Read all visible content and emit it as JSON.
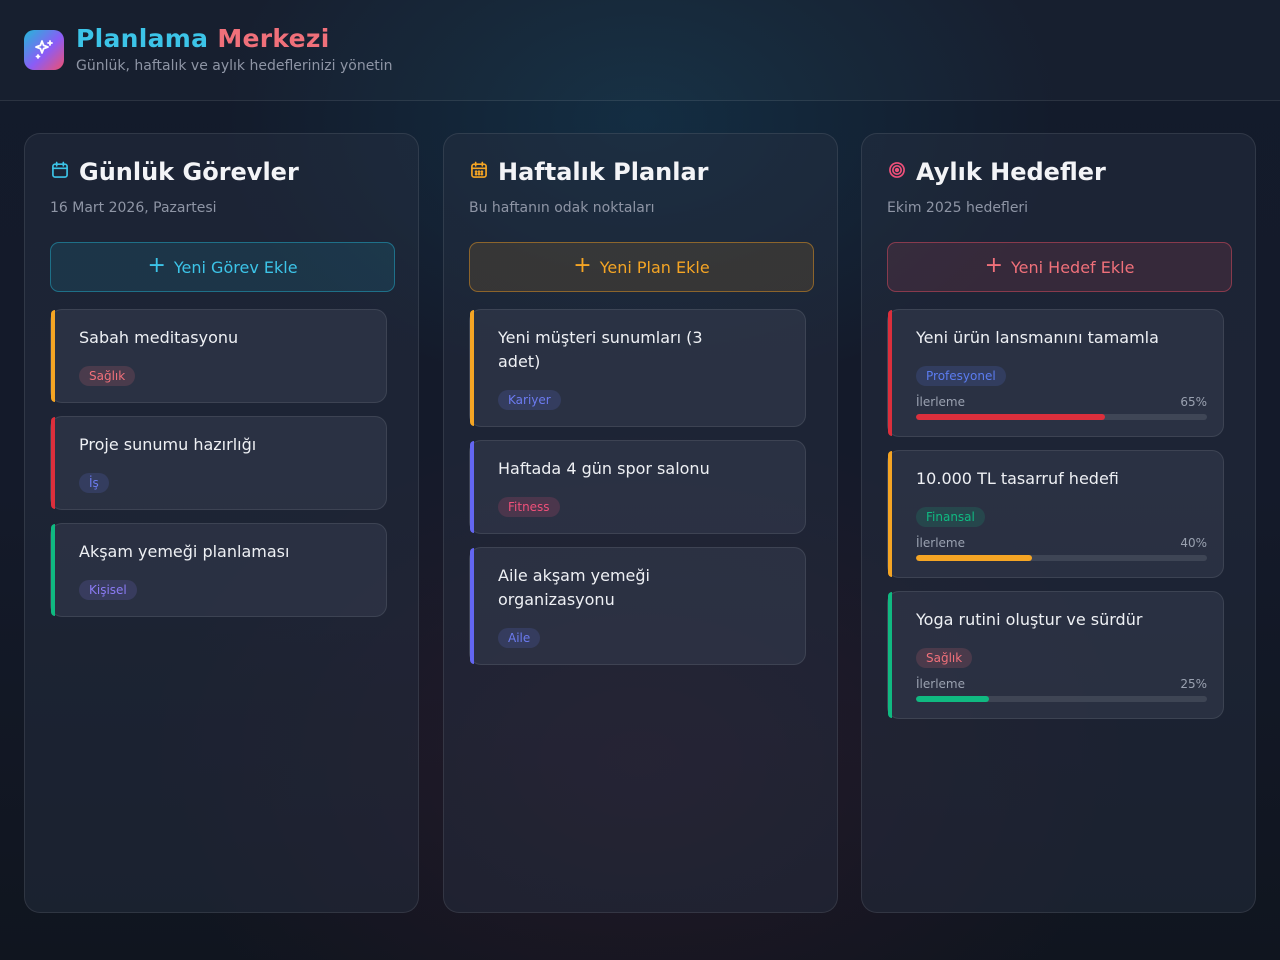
{
  "header": {
    "title_part1": "Planlama",
    "title_part2": "Merkezi",
    "subtitle": "Günlük, haftalık ve aylık hedeflerinizi yönetin",
    "logo_icon": "sparkles-icon"
  },
  "colors": {
    "cyan": "#3cc4e8",
    "orange": "#f5a524",
    "red": "#f0707a",
    "accent_red": "#dc2f3c",
    "accent_green": "#10b981",
    "accent_indigo": "#6366f1"
  },
  "daily": {
    "icon": "calendar-icon",
    "title": "Günlük Görevler",
    "subtitle": "16 Mart 2026, Pazartesi",
    "add_label": "Yeni Görev Ekle",
    "cards": [
      {
        "title": "Sabah meditasyonu",
        "tag": "Sağlık",
        "tag_color": "#f0707a",
        "accent": "#f5a524"
      },
      {
        "title": "Proje sunumu hazırlığı",
        "tag": "İş",
        "tag_color": "#6c7bf0",
        "accent": "#dc2f3c"
      },
      {
        "title": "Akşam yemeği planlaması",
        "tag": "Kişisel",
        "tag_color": "#8b7bf5",
        "accent": "#10b981"
      }
    ]
  },
  "weekly": {
    "icon": "calendar-grid-icon",
    "title": "Haftalık Planlar",
    "subtitle": "Bu haftanın odak noktaları",
    "add_label": "Yeni Plan Ekle",
    "cards": [
      {
        "title": "Yeni müşteri sunumları (3 adet)",
        "tag": "Kariyer",
        "tag_color": "#6c7bf0",
        "accent": "#f5a524"
      },
      {
        "title": "Haftada 4 gün spor salonu",
        "tag": "Fitness",
        "tag_color": "#f0507a",
        "accent": "#6366f1"
      },
      {
        "title": "Aile akşam yemeği organizasyonu",
        "tag": "Aile",
        "tag_color": "#6c7bf0",
        "accent": "#6366f1"
      }
    ]
  },
  "monthly": {
    "icon": "target-icon",
    "title": "Aylık Hedefler",
    "subtitle": "Ekim 2025 hedefleri",
    "add_label": "Yeni Hedef Ekle",
    "progress_label": "İlerleme",
    "cards": [
      {
        "title": "Yeni ürün lansmanını tamamla",
        "tag": "Profesyonel",
        "tag_color": "#5b7cf0",
        "accent": "#dc2f3c",
        "progress": 65,
        "progress_text": "65%"
      },
      {
        "title": "10.000 TL tasarruf hedefi",
        "tag": "Finansal",
        "tag_color": "#10b981",
        "accent": "#f5a524",
        "progress": 40,
        "progress_text": "40%"
      },
      {
        "title": "Yoga rutini oluştur ve sürdür",
        "tag": "Sağlık",
        "tag_color": "#f0707a",
        "accent": "#10b981",
        "progress": 25,
        "progress_text": "25%"
      }
    ]
  }
}
